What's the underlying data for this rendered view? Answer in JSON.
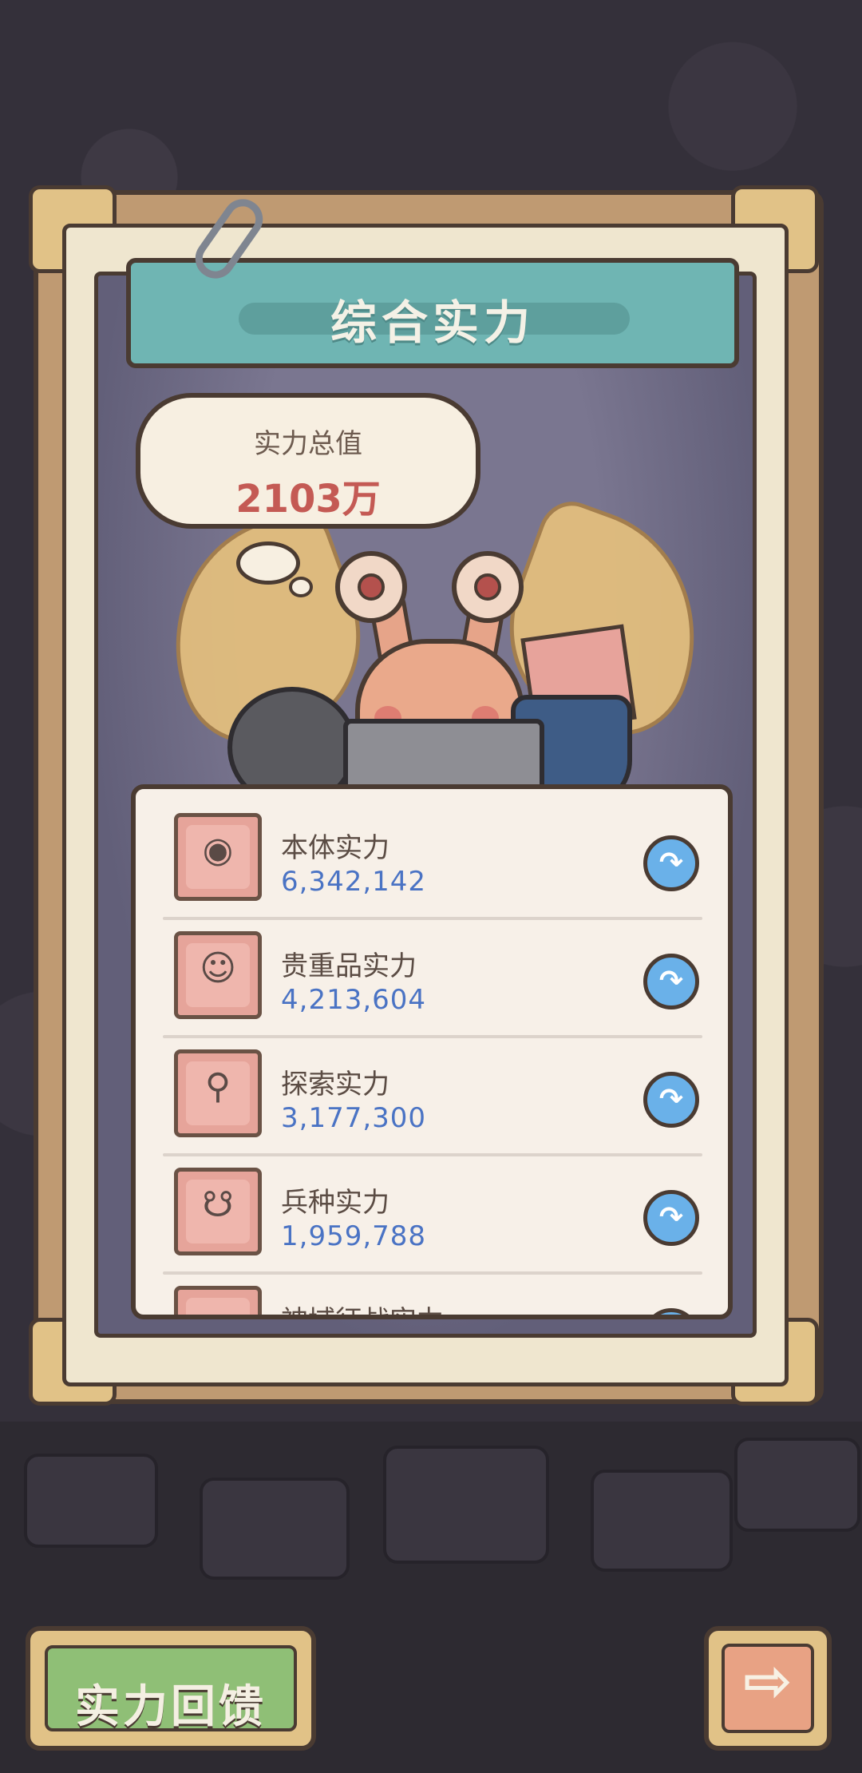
{
  "title": "综合实力",
  "total": {
    "label": "实力总值",
    "value": "2103万"
  },
  "items": [
    {
      "name": "本体实力",
      "value": "6,342,142",
      "icon": "winged-snail-icon"
    },
    {
      "name": "贵重品实力",
      "value": "4,213,604",
      "icon": "statue-bust-icon"
    },
    {
      "name": "探索实力",
      "value": "3,177,300",
      "icon": "magnifier-icon"
    },
    {
      "name": "兵种实力",
      "value": "1,959,788",
      "icon": "soldier-snail-icon"
    },
    {
      "name": "神域征战实力",
      "value": "",
      "icon": "partial-icon"
    }
  ],
  "buttons": {
    "feedback": "实力回馈",
    "next_icon": "right-arrow-icon"
  },
  "glyphs": {
    "detail": "↷",
    "next": "⇨"
  }
}
